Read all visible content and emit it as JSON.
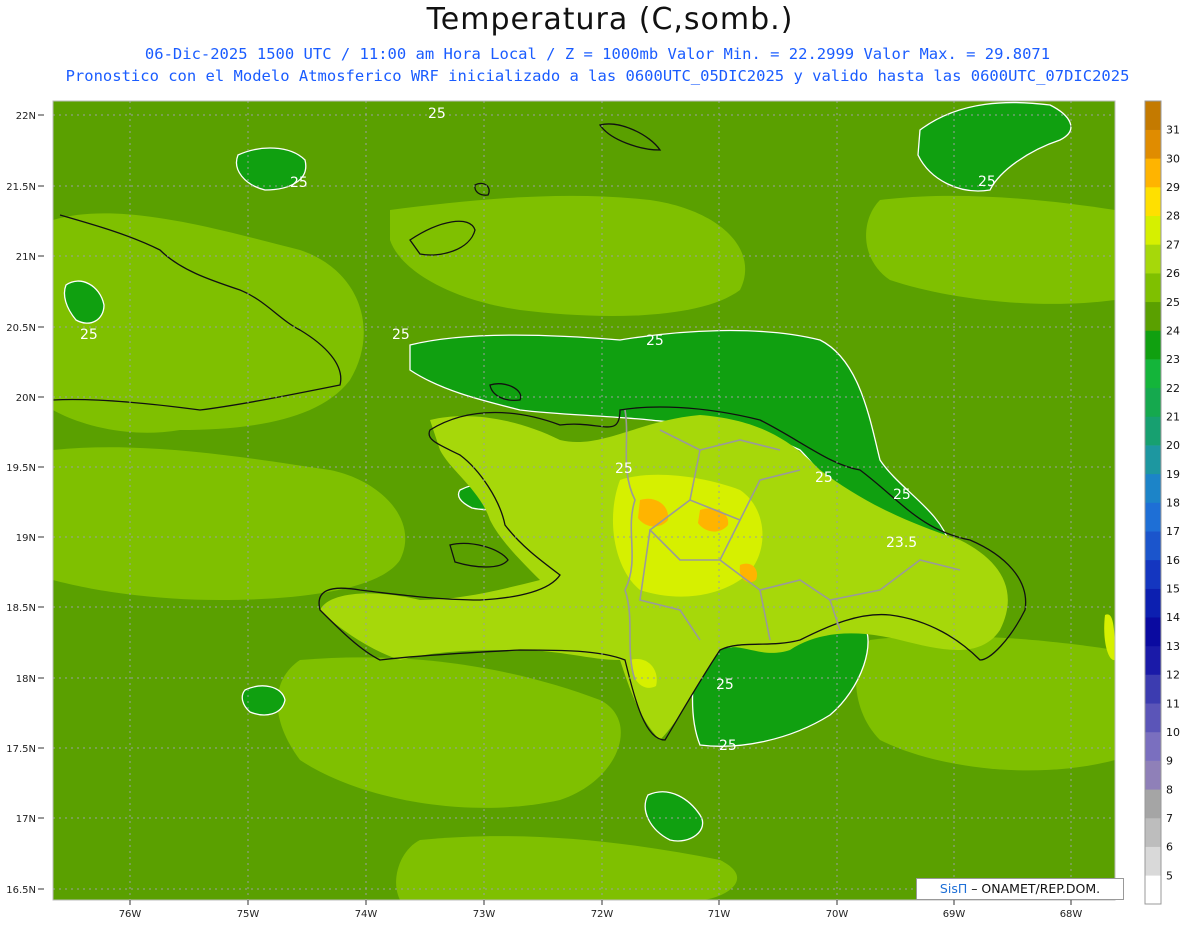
{
  "header": {
    "title": "Temperatura (C,somb.)",
    "subtitle_1": "06-Dic-2025 1500 UTC / 11:00 am Hora Local / Z = 1000mb  Valor Min. = 22.2999  Valor Max. = 29.8071",
    "subtitle_2": "Pronostico con el Modelo Atmosferico WRF inicializado a las 0600UTC_05DIC2025 y valido hasta las  0600UTC_07DIC2025"
  },
  "axes": {
    "lat_labels": [
      "22N",
      "21.5N",
      "21N",
      "20.5N",
      "20N",
      "19.5N",
      "19N",
      "18.5N",
      "18N",
      "17.5N",
      "17N",
      "16.5N"
    ],
    "lon_labels": [
      "76W",
      "75W",
      "74W",
      "73W",
      "72W",
      "71W",
      "70W",
      "69W",
      "68W"
    ]
  },
  "colorbar": {
    "levels": [
      5,
      6,
      7,
      8,
      9,
      10,
      11,
      12,
      13,
      14,
      15,
      16,
      17,
      18,
      19,
      20,
      21,
      22,
      23,
      24,
      25,
      26,
      27,
      28,
      29,
      30,
      31
    ],
    "colors": [
      "#ffffff",
      "#d9d9d9",
      "#bdbdbd",
      "#a5a5a5",
      "#8f80b8",
      "#7a6fbf",
      "#5b55b8",
      "#3c3cb0",
      "#1a1aa8",
      "#0a0aa0",
      "#0c1fb0",
      "#1436c0",
      "#1b55cc",
      "#1e6fd6",
      "#1c84c8",
      "#1d97a0",
      "#17a070",
      "#15a94e",
      "#14b53a",
      "#10a010",
      "#5aa000",
      "#7fc000",
      "#a6d80a",
      "#d6f000",
      "#ffe000",
      "#ffb400",
      "#e08c00",
      "#c47a00"
    ]
  },
  "contour_labels": [
    "25",
    "25",
    "25",
    "25",
    "25",
    "25",
    "25",
    "25",
    "25",
    "25",
    "25",
    "23.5"
  ],
  "credit": {
    "brand": "SisΠ",
    "text": " – ONAMET/REP.DOM."
  },
  "colors": {
    "sea_base": "#5aa000",
    "warm_green": "#7fc000",
    "light_green": "#a6d80a",
    "cool_green": "#14b53a",
    "yellow": "#d6f000",
    "orange": "#ffb400"
  }
}
